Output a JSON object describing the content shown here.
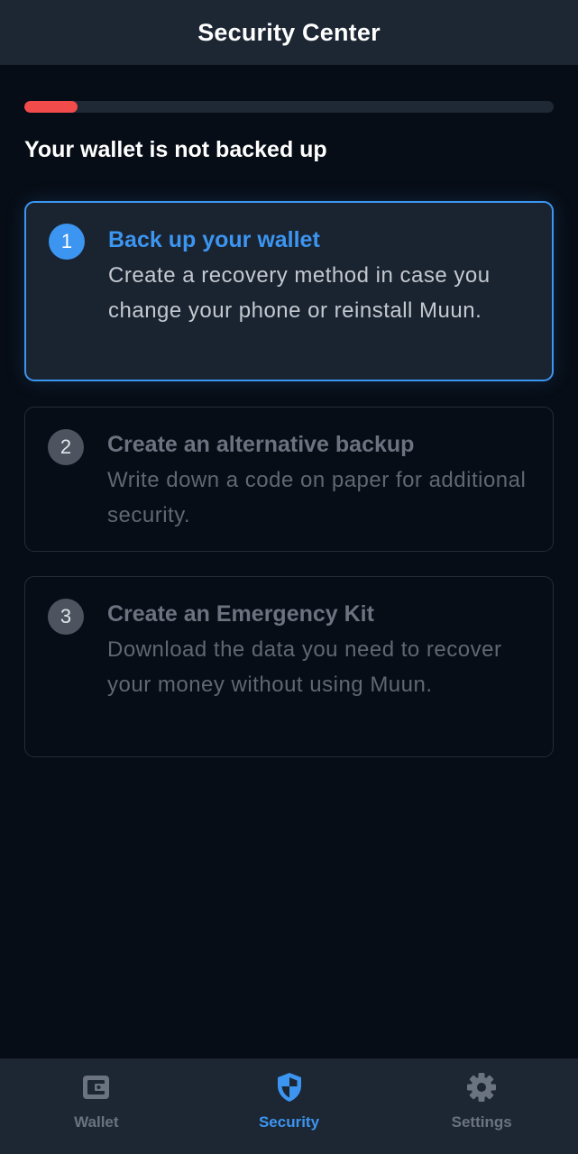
{
  "header": {
    "title": "Security Center"
  },
  "progress": {
    "fraction": 0.1,
    "color": "#f24b4b"
  },
  "status": {
    "text": "Your wallet is not backed up"
  },
  "tasks": [
    {
      "number": "1",
      "title": "Back up your wallet",
      "description": "Create a recovery method in case you change your phone or reinstall Muun.",
      "active": true
    },
    {
      "number": "2",
      "title": "Create an alternative backup",
      "description": "Write down a code on paper for additional security.",
      "active": false
    },
    {
      "number": "3",
      "title": "Create an Emergency Kit",
      "description": "Download the data you need to recover your money without using Muun.",
      "active": false
    }
  ],
  "nav": {
    "items": [
      {
        "label": "Wallet",
        "icon": "wallet-icon",
        "active": false
      },
      {
        "label": "Security",
        "icon": "shield-icon",
        "active": true
      },
      {
        "label": "Settings",
        "icon": "gear-icon",
        "active": false
      }
    ]
  },
  "colors": {
    "accent": "#3c95f0",
    "background": "#070d16",
    "surface": "#1d2633",
    "danger": "#f24b4b",
    "inactive": "#6b7280"
  }
}
